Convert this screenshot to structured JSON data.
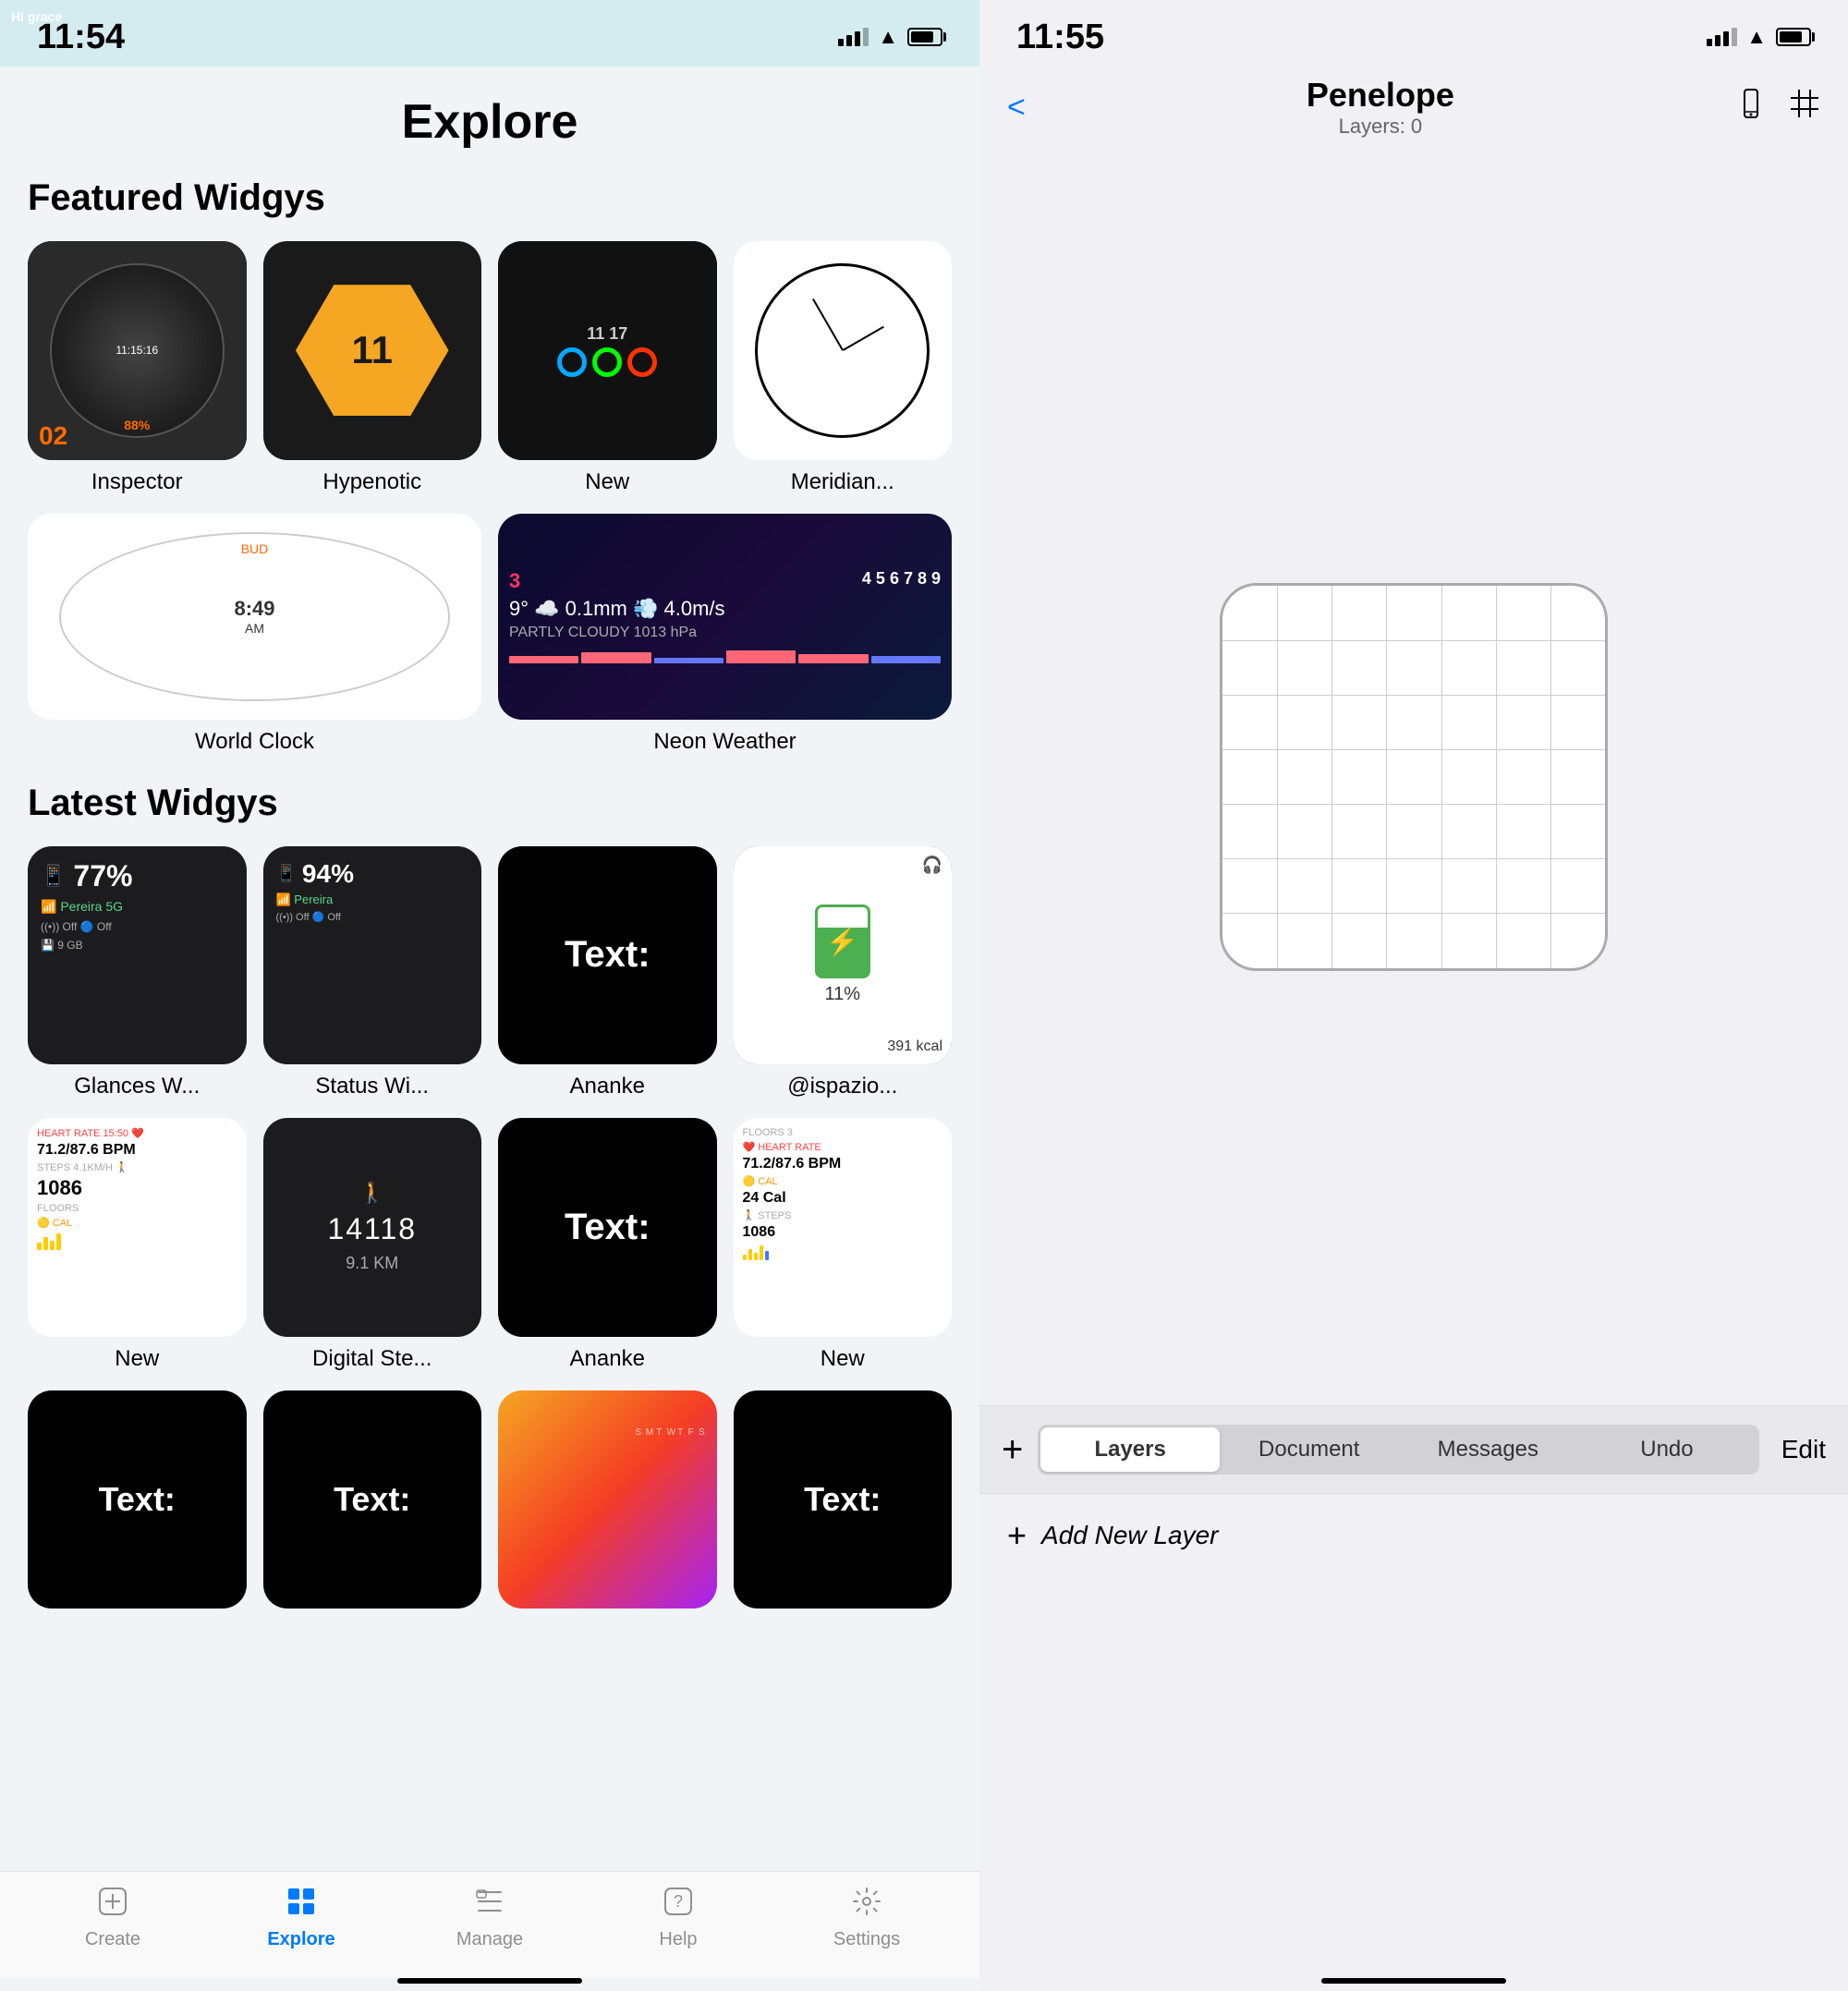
{
  "left": {
    "statusBar": {
      "time": "11:54",
      "signal": [
        3,
        5,
        7,
        9,
        11
      ],
      "wifi": "wifi",
      "battery": "battery"
    },
    "pageTitle": "Explore",
    "sections": [
      {
        "title": "Featured Widgys",
        "widgets": [
          {
            "label": "Inspector",
            "type": "inspector"
          },
          {
            "label": "Hypenotic",
            "type": "hypenotic"
          },
          {
            "label": "New",
            "type": "new-watch"
          },
          {
            "label": "Meridian...",
            "type": "meridian"
          }
        ],
        "wide": [
          {
            "label": "World Clock",
            "type": "worldclock"
          },
          {
            "label": "Neon Weather",
            "type": "neon"
          }
        ]
      },
      {
        "title": "Latest Widgys",
        "widgets": [
          {
            "label": "Glances W...",
            "type": "glances"
          },
          {
            "label": "Status Wi...",
            "type": "status"
          },
          {
            "label": "Ananke",
            "type": "ananke"
          },
          {
            "label": "@ispazio...",
            "type": "ispazio"
          }
        ],
        "widgets2": [
          {
            "label": "New",
            "type": "new-health"
          },
          {
            "label": "Digital Ste...",
            "type": "digital"
          },
          {
            "label": "Ananke",
            "type": "ananke2"
          },
          {
            "label": "New",
            "type": "new-health2"
          }
        ],
        "widgets3": [
          {
            "label": "",
            "type": "text-black"
          },
          {
            "label": "",
            "type": "text-black2"
          },
          {
            "label": "",
            "type": "hi-grace"
          },
          {
            "label": "",
            "type": "text-black3"
          }
        ]
      }
    ],
    "tabBar": {
      "items": [
        {
          "id": "create",
          "label": "Create",
          "icon": "➕",
          "active": false
        },
        {
          "id": "explore",
          "label": "Explore",
          "icon": "🔳",
          "active": true
        },
        {
          "id": "manage",
          "label": "Manage",
          "icon": "📁",
          "active": false
        },
        {
          "id": "help",
          "label": "Help",
          "icon": "❓",
          "active": false
        },
        {
          "id": "settings",
          "label": "Settings",
          "icon": "⚙️",
          "active": false
        }
      ]
    }
  },
  "right": {
    "statusBar": {
      "time": "11:55"
    },
    "navBar": {
      "backLabel": "<",
      "title": "Penelope",
      "subtitle": "Layers: 0",
      "deviceIcon": "device",
      "gridIcon": "grid"
    },
    "layersPanel": {
      "addButton": "+",
      "tabs": [
        {
          "label": "Layers",
          "active": true
        },
        {
          "label": "Document",
          "active": false
        },
        {
          "label": "Messages",
          "active": false
        },
        {
          "label": "Undo",
          "active": false
        }
      ],
      "editLabel": "Edit",
      "addLayerLabel": "Add New Layer"
    }
  }
}
